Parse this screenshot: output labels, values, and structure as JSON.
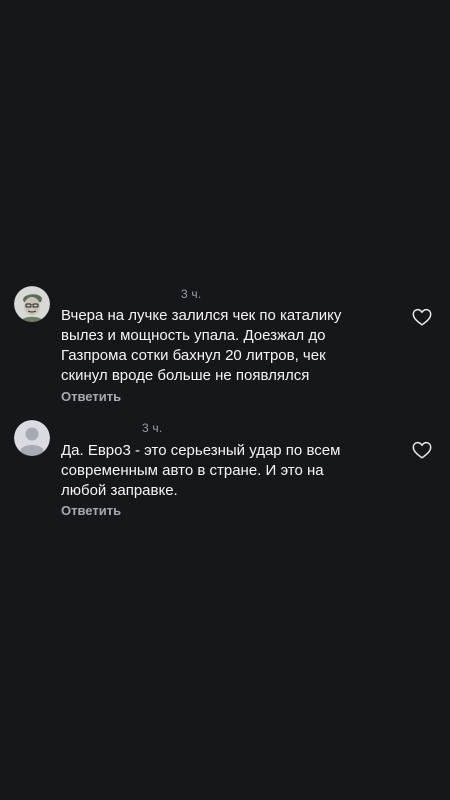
{
  "comments": [
    {
      "time": "3 ч.",
      "text": "Вчера на лучке залился чек по каталику\nвылез и мощность упала. Доезжал до\nГазпрома сотки бахнул 20 литров, чек\nскинул вроде больше не появлялся",
      "reply_label": "Ответить",
      "avatar_icon": "cartoon-face-avatar",
      "like_icon": "heart-outline-icon"
    },
    {
      "time": "3 ч.",
      "text": "Да. Евро3 - это серьезный удар по всем\nсовременным авто в стране. И это на\nлюбой заправке.",
      "reply_label": "Ответить",
      "avatar_icon": "default-user-avatar",
      "like_icon": "heart-outline-icon"
    }
  ]
}
